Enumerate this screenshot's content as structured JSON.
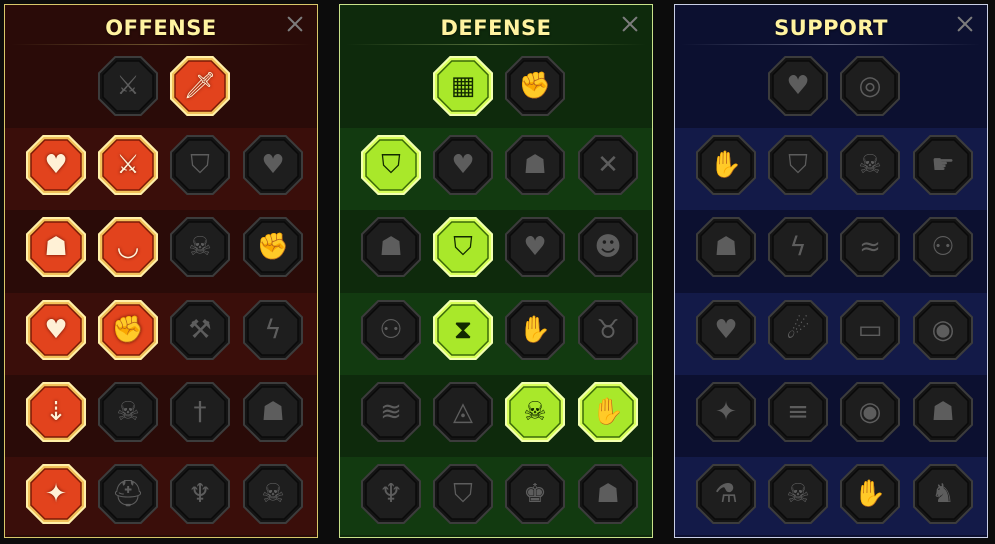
{
  "colors": {
    "offense_bg": "#2a0b08",
    "offense_band": "#3a0e0a",
    "offense_border": "#d8c86a",
    "defense_bg": "#0e2a0c",
    "defense_band": "#123a10",
    "defense_border": "#c9e28a",
    "support_bg": "#0c1030",
    "support_band": "#131a48",
    "support_border": "#c9cfe6",
    "title": "#fff3a0",
    "inactive_node": "#1e1e1e",
    "offense_active": "#e2431d",
    "defense_active": "#a9e82a"
  },
  "panels": [
    {
      "key": "offense",
      "title": "OFFENSE",
      "header_row": [
        {
          "icon": "crossed-swords-icon",
          "glyph": "⚔",
          "active": false
        },
        {
          "icon": "slashing-blade-icon",
          "glyph": "🗡",
          "active": true
        }
      ],
      "rows": [
        [
          {
            "icon": "horned-demon-heart-icon",
            "glyph": "♥",
            "active": true
          },
          {
            "icon": "blade-swipe-icon",
            "glyph": "⚔",
            "active": true
          },
          {
            "icon": "shield-arrow-icon",
            "glyph": "⛉",
            "active": false
          },
          {
            "icon": "cracked-heart-icon",
            "glyph": "♥",
            "active": false
          }
        ],
        [
          {
            "icon": "bound-prisoner-icon",
            "glyph": "☗",
            "active": true
          },
          {
            "icon": "fanged-maw-icon",
            "glyph": "◡",
            "active": true
          },
          {
            "icon": "skull-slash-icon",
            "glyph": "☠",
            "active": false
          },
          {
            "icon": "gripping-fist-icon",
            "glyph": "✊",
            "active": false
          }
        ],
        [
          {
            "icon": "pierced-heart-icon",
            "glyph": "♥",
            "active": true
          },
          {
            "icon": "fist-hammer-icon",
            "glyph": "✊",
            "active": true
          },
          {
            "icon": "battle-axe-icon",
            "glyph": "⚒",
            "active": false
          },
          {
            "icon": "lightning-chain-icon",
            "glyph": "ϟ",
            "active": false
          }
        ],
        [
          {
            "icon": "arrows-in-pot-icon",
            "glyph": "⇣",
            "active": true
          },
          {
            "icon": "twin-skulls-icon",
            "glyph": "☠",
            "active": false
          },
          {
            "icon": "dagger-circle-icon",
            "glyph": "†",
            "active": false
          },
          {
            "icon": "charged-warrior-icon",
            "glyph": "☗",
            "active": false
          }
        ],
        [
          {
            "icon": "sparkling-sword-icon",
            "glyph": "✦",
            "active": true
          },
          {
            "icon": "knight-helm-icon",
            "glyph": "⛑",
            "active": false
          },
          {
            "icon": "demon-lord-icon",
            "glyph": "♆",
            "active": false
          },
          {
            "icon": "spartan-skull-icon",
            "glyph": "☠",
            "active": false
          }
        ]
      ]
    },
    {
      "key": "defense",
      "title": "DEFENSE",
      "header_row": [
        {
          "icon": "armor-plates-icon",
          "glyph": "▦",
          "active": true
        },
        {
          "icon": "raised-fist-icon",
          "glyph": "✊",
          "active": false
        }
      ],
      "rows": [
        [
          {
            "icon": "layered-shield-icon",
            "glyph": "⛉",
            "active": true
          },
          {
            "icon": "heart-organ-icon",
            "glyph": "♥",
            "active": false
          },
          {
            "icon": "muscled-torso-icon",
            "glyph": "☗",
            "active": false
          },
          {
            "icon": "crossed-blades-icon",
            "glyph": "✕",
            "active": false
          }
        ],
        [
          {
            "icon": "guarding-figure-icon",
            "glyph": "☗",
            "active": false
          },
          {
            "icon": "shield-knight-icon",
            "glyph": "⛉",
            "active": true
          },
          {
            "icon": "heart-shield-icon",
            "glyph": "♥",
            "active": false
          },
          {
            "icon": "hooded-head-icon",
            "glyph": "☻",
            "active": false
          }
        ],
        [
          {
            "icon": "crowd-icon",
            "glyph": "⚇",
            "active": false
          },
          {
            "icon": "radiant-hourglass-icon",
            "glyph": "⧗",
            "active": true
          },
          {
            "icon": "open-hand-icon",
            "glyph": "✋",
            "active": false
          },
          {
            "icon": "bull-head-icon",
            "glyph": "♉",
            "active": false
          }
        ],
        [
          {
            "icon": "speed-runner-icon",
            "glyph": "≋",
            "active": false
          },
          {
            "icon": "water-drops-icon",
            "glyph": "◬",
            "active": false
          },
          {
            "icon": "sun-skull-icon",
            "glyph": "☠",
            "active": true
          },
          {
            "icon": "hand-shield-icon",
            "glyph": "✋",
            "active": true
          }
        ],
        [
          {
            "icon": "phoenix-guardian-icon",
            "glyph": "♆",
            "active": false
          },
          {
            "icon": "winged-shield-icon",
            "glyph": "⛉",
            "active": false
          },
          {
            "icon": "bearded-king-icon",
            "glyph": "♚",
            "active": false
          },
          {
            "icon": "flexing-brute-icon",
            "glyph": "☗",
            "active": false
          }
        ]
      ]
    },
    {
      "key": "support",
      "title": "SUPPORT",
      "header_row": [
        {
          "icon": "healing-heart-icon",
          "glyph": "♥",
          "active": false
        },
        {
          "icon": "spiral-hand-icon",
          "glyph": "◎",
          "active": false
        }
      ],
      "rows": [
        [
          {
            "icon": "praying-hands-icon",
            "glyph": "✋",
            "active": false
          },
          {
            "icon": "aura-shield-icon",
            "glyph": "⛉",
            "active": false
          },
          {
            "icon": "smoking-skull-icon",
            "glyph": "☠",
            "active": false
          },
          {
            "icon": "pointing-hand-icon",
            "glyph": "☛",
            "active": false
          }
        ],
        [
          {
            "icon": "blessed-figure-icon",
            "glyph": "☗",
            "active": false
          },
          {
            "icon": "lightning-shield-icon",
            "glyph": "ϟ",
            "active": false
          },
          {
            "icon": "shattered-ground-icon",
            "glyph": "≈",
            "active": false
          },
          {
            "icon": "twin-figures-icon",
            "glyph": "⚇",
            "active": false
          }
        ],
        [
          {
            "icon": "chained-heart-icon",
            "glyph": "♥",
            "active": false
          },
          {
            "icon": "comet-fire-icon",
            "glyph": "☄",
            "active": false
          },
          {
            "icon": "open-book-icon",
            "glyph": "▭",
            "active": false
          },
          {
            "icon": "fierce-eyes-icon",
            "glyph": "◉",
            "active": false
          }
        ],
        [
          {
            "icon": "compass-star-icon",
            "glyph": "✦",
            "active": false
          },
          {
            "icon": "winged-boot-icon",
            "glyph": "≡",
            "active": false
          },
          {
            "icon": "all-seeing-eye-icon",
            "glyph": "◉",
            "active": false
          },
          {
            "icon": "kicking-fighter-icon",
            "glyph": "☗",
            "active": false
          }
        ],
        [
          {
            "icon": "potion-flask-icon",
            "glyph": "⚗",
            "active": false
          },
          {
            "icon": "winged-skull-icon",
            "glyph": "☠",
            "active": false
          },
          {
            "icon": "grasping-hands-icon",
            "glyph": "✋",
            "active": false
          },
          {
            "icon": "eagle-head-icon",
            "glyph": "♞",
            "active": false
          }
        ]
      ]
    }
  ]
}
